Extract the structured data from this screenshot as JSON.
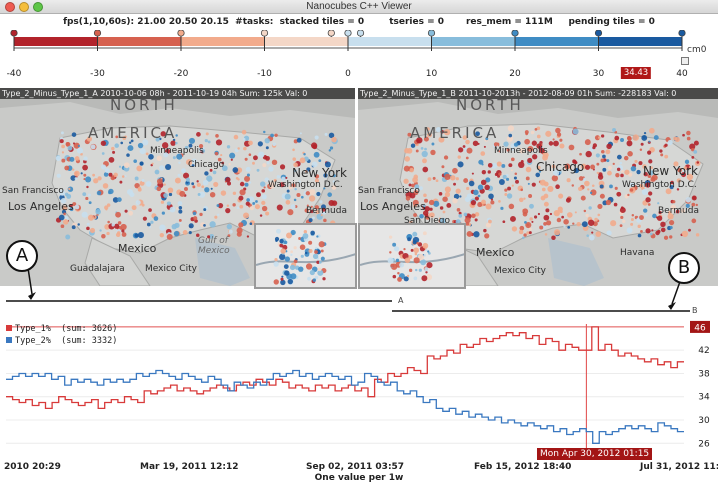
{
  "window": {
    "title": "Nanocubes C++ Viewer"
  },
  "status": {
    "text": "fps(1,10,60s): 21.00 20.50 20.15  #tasks:  stacked tiles = 0        tseries = 0       res_mem = 111M     pending tiles = 0"
  },
  "colormap": {
    "name_label": "cm0",
    "ticks": [
      "-40",
      "-30",
      "-20",
      "-10",
      "0",
      "10",
      "20",
      "30",
      "40"
    ],
    "marker_value": "34.43",
    "colors": [
      "#b2232b",
      "#d6614f",
      "#f2ab8c",
      "#f4d7c7",
      "#c8dfee",
      "#88bddc",
      "#3f8cc4",
      "#1a5aa0"
    ]
  },
  "maps": {
    "left_caption": "Type_2_Minus_Type_1_A   2010-10-06 08h - 2011-10-19 04h  Sum: 125k Val: 0",
    "right_caption": "Type_2_Minus_Type_1_B   2011-10-2013h - 2012-08-09 01h Sum: -228183 Val: 0",
    "labels": {
      "north": "NORTH",
      "america": "AMERICA",
      "minneapolis": "Minneapolis",
      "chicago": "Chicago",
      "new_york": "New York",
      "washington": "Washington D.C.",
      "san_francisco": "San Francisco",
      "los_angeles": "Los Angeles",
      "bermuda": "Bermuda",
      "mexico": "Mexico",
      "havana": "Havana",
      "guadalajara": "Guadalajara",
      "mexico_city": "Mexico City",
      "gulf": "Gulf of Mexico",
      "san_diego": "San Diego"
    }
  },
  "callouts": {
    "a": "A",
    "b": "B"
  },
  "spans": {
    "a": "A",
    "b": "B"
  },
  "chart_data": {
    "type": "line",
    "title": "",
    "xlabel": "One value per 1w",
    "ylabel": "",
    "x_tick_labels": [
      "2010 20:29",
      "Mar 19, 2011 12:12",
      "Sep 02, 2011 03:57",
      "Feb 15, 2012 18:40",
      "Jul 31, 2012 11:23"
    ],
    "y_ticks": [
      26,
      30,
      34,
      38,
      42,
      46
    ],
    "ylim": [
      24.5,
      46.5
    ],
    "hover": {
      "date": "Mon Apr 30, 2012 01:15",
      "value": "46",
      "position_fraction": 0.856
    },
    "legend": [
      {
        "name": "Type_1%",
        "sum": "(sum: 3626)",
        "color": "#d83a3a"
      },
      {
        "name": "Type_2%",
        "sum": "(sum: 3332)",
        "color": "#3a78c0"
      }
    ],
    "series": [
      {
        "name": "Type_1%",
        "color": "#d83a3a",
        "values": [
          34,
          33.5,
          33,
          33.5,
          32.5,
          33,
          32,
          33,
          34,
          33.5,
          33,
          32.5,
          33,
          33.5,
          32,
          33,
          33.5,
          33,
          34,
          33.5,
          33,
          35,
          34.5,
          35,
          35.5,
          36,
          35,
          35.5,
          35,
          34.5,
          35,
          35.5,
          36,
          35.5,
          35,
          36,
          36.5,
          36,
          37,
          36.5,
          36,
          37,
          36.5,
          35.5,
          36,
          35.5,
          35,
          36,
          35.5,
          36,
          35,
          35.5,
          36,
          35,
          35.5,
          34,
          37,
          36.5,
          38,
          37.5,
          38,
          39,
          38.5,
          38,
          41,
          40.5,
          41,
          42,
          41.5,
          43,
          42.5,
          43,
          44,
          43.5,
          44,
          44.5,
          45,
          44.5,
          45,
          44,
          44.5,
          43,
          44,
          43.5,
          42,
          43,
          42.5,
          42,
          42,
          46,
          42,
          43,
          42,
          41,
          41.5,
          41,
          40.5,
          40,
          40.5,
          39.5,
          40,
          39,
          40
        ]
      },
      {
        "name": "Type_2%",
        "color": "#3a78c0",
        "values": [
          37,
          37.5,
          38,
          37.5,
          38,
          37.5,
          38,
          37,
          37.5,
          36,
          37,
          36.5,
          37,
          36.5,
          36,
          37,
          36.5,
          37,
          36.5,
          37,
          38,
          37.5,
          38,
          38.5,
          38,
          37.5,
          37,
          38,
          37.5,
          37,
          36.5,
          37.5,
          37,
          36,
          35,
          36.5,
          36,
          35.5,
          36.5,
          36,
          37,
          38,
          37.5,
          38,
          38.5,
          37.5,
          38,
          37,
          37.5,
          38,
          37.5,
          37,
          37.5,
          36,
          36.5,
          38,
          37.5,
          36.5,
          36,
          36.5,
          35,
          34.5,
          35,
          34,
          33,
          33.5,
          32,
          31.5,
          32,
          31,
          31.5,
          30.5,
          31,
          30.5,
          30,
          30.5,
          29.5,
          30,
          29.5,
          29,
          29.5,
          29,
          28.5,
          29,
          28,
          28.5,
          27.5,
          28,
          28.5,
          28,
          26,
          28,
          27.5,
          28,
          28.5,
          29,
          28.5,
          29,
          28.5,
          28,
          29.5,
          29,
          28.5,
          28
        ]
      }
    ]
  }
}
